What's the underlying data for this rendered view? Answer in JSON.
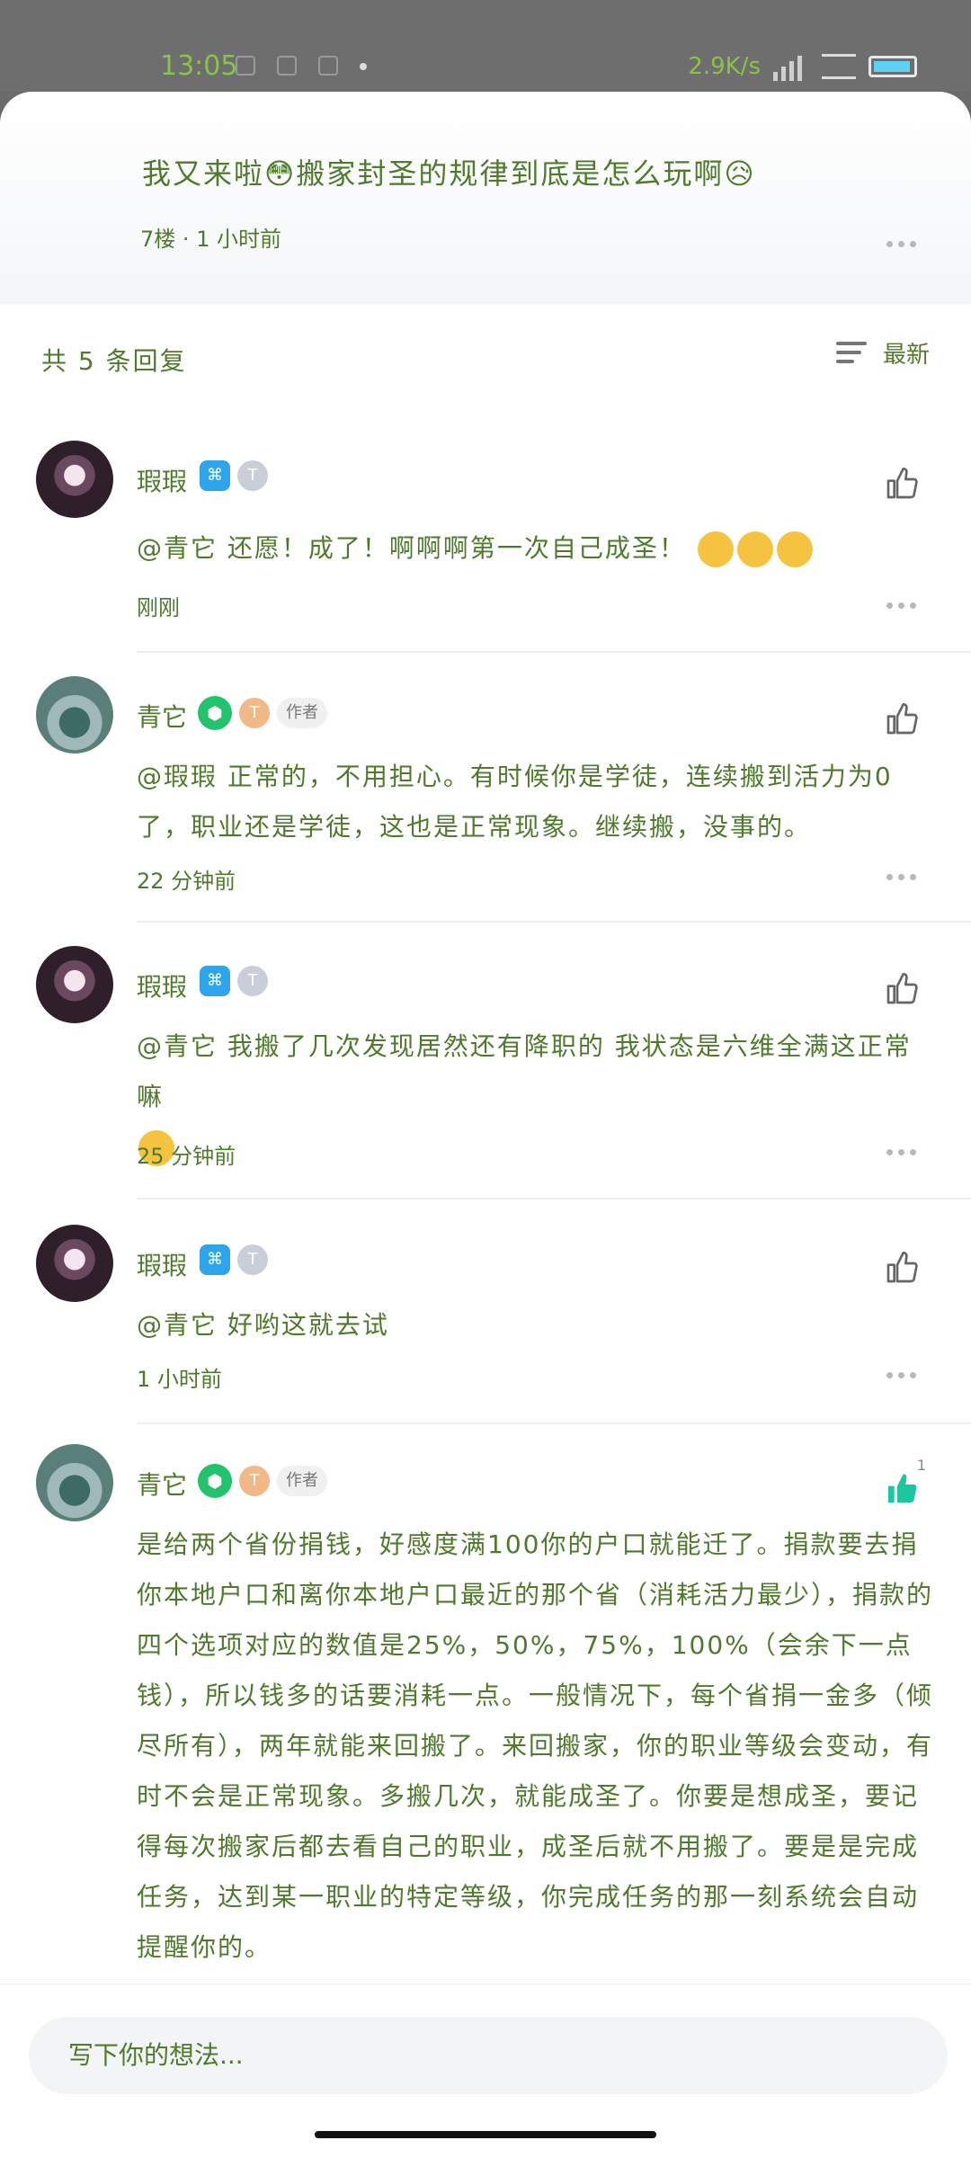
{
  "status_bar": {
    "time": "13:05",
    "speed": "2.9K/s"
  },
  "parent_comment": {
    "text": "我又来啦😳搬家封圣的规律到底是怎么玩啊😥",
    "meta": "7楼 · 1 小时前"
  },
  "replies_header": {
    "count_label": "共 5 条回复",
    "sort_label": "最新"
  },
  "comments": [
    {
      "name": "瑕瑕",
      "text": "@青它 还愿！成了！啊啊啊第一次自己成圣！",
      "emoji_count": 3,
      "time": "刚刚"
    },
    {
      "name": "青它",
      "author_tag": "作者",
      "text": "@瑕瑕 正常的，不用担心。有时候你是学徒，连续搬到活力为0了，职业还是学徒，这也是正常现象。继续搬，没事的。",
      "time": "22 分钟前"
    },
    {
      "name": "瑕瑕",
      "text": "@青它 我搬了几次发现居然还有降职的 我状态是六维全满这正常嘛",
      "time": "25 分钟前"
    },
    {
      "name": "瑕瑕",
      "text": "@青它 好哟这就去试",
      "time": "1 小时前"
    },
    {
      "name": "青它",
      "author_tag": "作者",
      "text": "是给两个省份捐钱，好感度满100你的户口就能迁了。捐款要去捐你本地户口和离你本地户口最近的那个省（消耗活力最少），捐款的四个选项对应的数值是25%，50%，75%，100%（会余下一点钱），所以钱多的话要消耗一点。一般情况下，每个省捐一金多（倾尽所有），两年就能来回搬了。来回搬家，你的职业等级会变动，有时不会是正常现象。多搬几次，就能成圣了。你要是想成圣，要记得每次搬家后都去看自己的职业，成圣后就不用搬了。要是是完成任务，达到某一职业的特定等级，你完成任务的那一刻系统会自动提醒你的。",
      "time": "",
      "liked": true,
      "like_count": "1"
    }
  ],
  "input": {
    "placeholder": "写下你的想法..."
  },
  "colors": {
    "text_green": "#4f7a2c",
    "accent_blue": "#2ea5ea",
    "like_active": "#1ec6a0"
  }
}
